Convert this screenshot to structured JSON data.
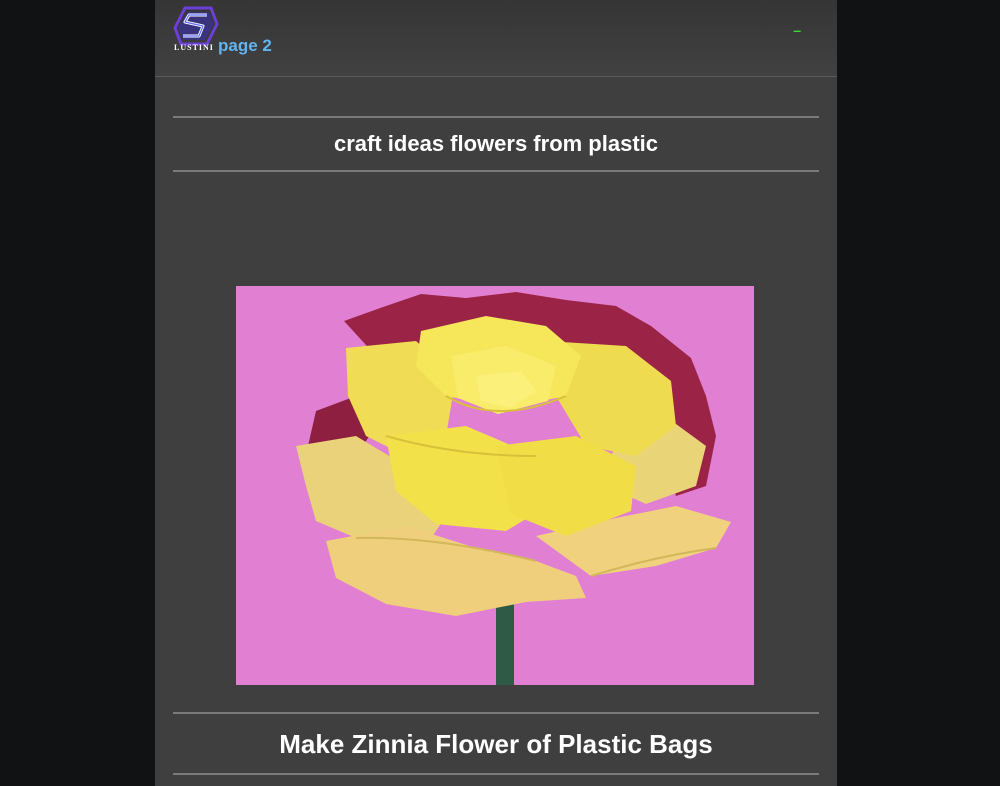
{
  "header": {
    "logo_text": "LUSTINI",
    "page_link": "page 2",
    "menu_dash": "–"
  },
  "main": {
    "title": "craft ideas flowers from plastic",
    "image_caption": "Make Zinnia Flower of Plastic Bags"
  },
  "colors": {
    "page_bg": "#3f3f3f",
    "outer_bg": "#111214",
    "link": "#62b3ee",
    "menu_dash": "#33dd33",
    "photo_bg": "#e17fd2",
    "flower_yellow": "#f2e04a"
  }
}
